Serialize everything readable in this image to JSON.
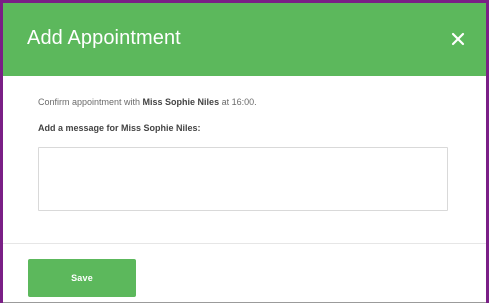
{
  "dialog": {
    "title": "Add Appointment",
    "close_icon": "close-icon",
    "confirm_prefix": "Confirm appointment with ",
    "patient_name": "Miss Sophie Niles",
    "confirm_mid": " at ",
    "time": "16:00",
    "confirm_suffix": ".",
    "message_label": "Add a message for Miss Sophie Niles:",
    "message_value": "",
    "save_label": "Save"
  },
  "colors": {
    "header_bg": "#5cb85c",
    "button_bg": "#5cb85c",
    "frame_border": "#7a1f86",
    "text_muted": "#6b6b6b",
    "text_strong": "#444444"
  }
}
